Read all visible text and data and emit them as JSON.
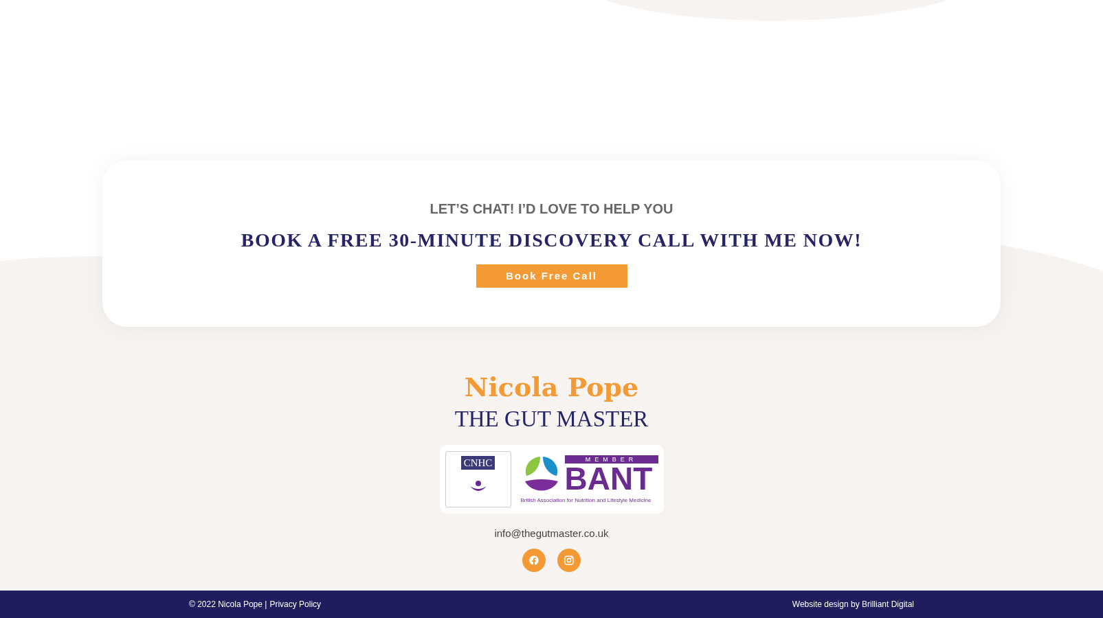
{
  "cta": {
    "eyebrow": "LET’S CHAT! I’D LOVE TO HELP YOU",
    "heading": "BOOK A FREE 30-MINUTE DISCOVERY CALL WITH ME NOW!",
    "button": "Book Free Call"
  },
  "brand": {
    "name": "Nicola Pope",
    "tagline": "THE GUT MASTER"
  },
  "badges": {
    "cnhc": "CNHC",
    "bant_member": "MEMBER",
    "bant": "BANT",
    "bant_full": "British Association for Nutrition and Lifestyle Medicine"
  },
  "email": "info@thegutmaster.co.uk",
  "footer": {
    "copyright": "© 2022 Nicola Pope |",
    "privacy": "Privacy Policy",
    "credit": "Website design by Brilliant Digital"
  }
}
